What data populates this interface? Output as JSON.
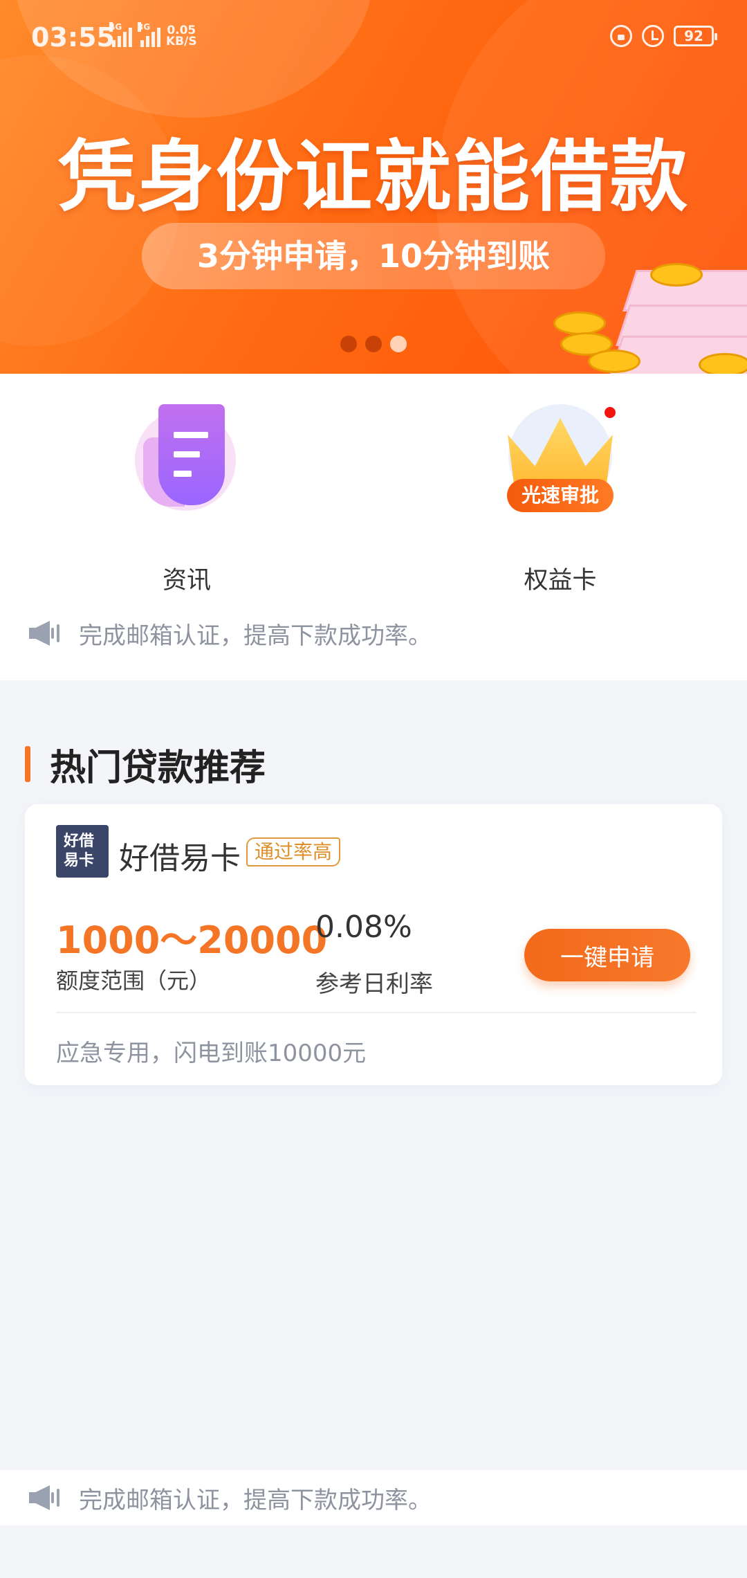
{
  "status_bar": {
    "time": "03:55",
    "signal_1": "4G",
    "signal_2": "3G",
    "speed_value": "0.05",
    "speed_unit": "KB/S",
    "battery": "92"
  },
  "banner": {
    "title": "凭身份证就能借款",
    "subtitle": "3分钟申请，10分钟到账",
    "page_count": 3,
    "active_page": 3
  },
  "quick_entries": {
    "news": {
      "label": "资讯",
      "icon": "document-icon"
    },
    "rights": {
      "label": "权益卡",
      "badge": "光速审批",
      "icon": "crown-icon"
    }
  },
  "notice": {
    "text": "完成邮箱认证，提高下款成功率。"
  },
  "hot_loans": {
    "title": "热门贷款推荐",
    "items": [
      {
        "logo_line1": "好借",
        "logo_line2": "易卡",
        "name": "好借易卡",
        "tag": "通过率高",
        "amount": "1000～20000",
        "amount_label": "额度范围（元）",
        "rate": "0.08%",
        "rate_label": "参考日利率",
        "apply_label": "一键申请",
        "desc": "应急专用，闪电到账10000元"
      }
    ]
  },
  "colors": {
    "accent": "#f47525",
    "banner": "#ff6a12",
    "badge_red": "#f1150f"
  }
}
